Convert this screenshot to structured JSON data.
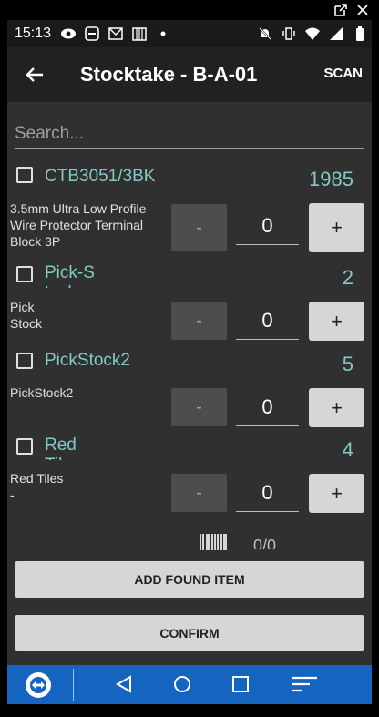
{
  "status_bar": {
    "time": "15:13"
  },
  "toolbar": {
    "title": "Stocktake - B-A-01",
    "scan_label": "SCAN"
  },
  "search": {
    "placeholder": "Search..."
  },
  "items": [
    {
      "code": "CTB3051/3BK",
      "quantity": "1985",
      "description": "3.5mm Ultra Low Profile Wire Protector Terminal Block 3P",
      "count": "0",
      "minus": "-",
      "plus": "+"
    },
    {
      "code": "Pick-Stock",
      "quantity": "2",
      "description": "Pick\nStock",
      "count": "0",
      "minus": "-",
      "plus": "+"
    },
    {
      "code": "PickStock2",
      "quantity": "5",
      "description": "PickStock2",
      "count": "0",
      "minus": "-",
      "plus": "+"
    },
    {
      "code": "Red Tiles",
      "quantity": "4",
      "description": "Red Tiles\n    -",
      "count": "0",
      "minus": "-",
      "plus": "+"
    }
  ],
  "scan_counter": "0/0",
  "buttons": {
    "add_found_item": "ADD FOUND ITEM",
    "confirm": "CONFIRM"
  }
}
